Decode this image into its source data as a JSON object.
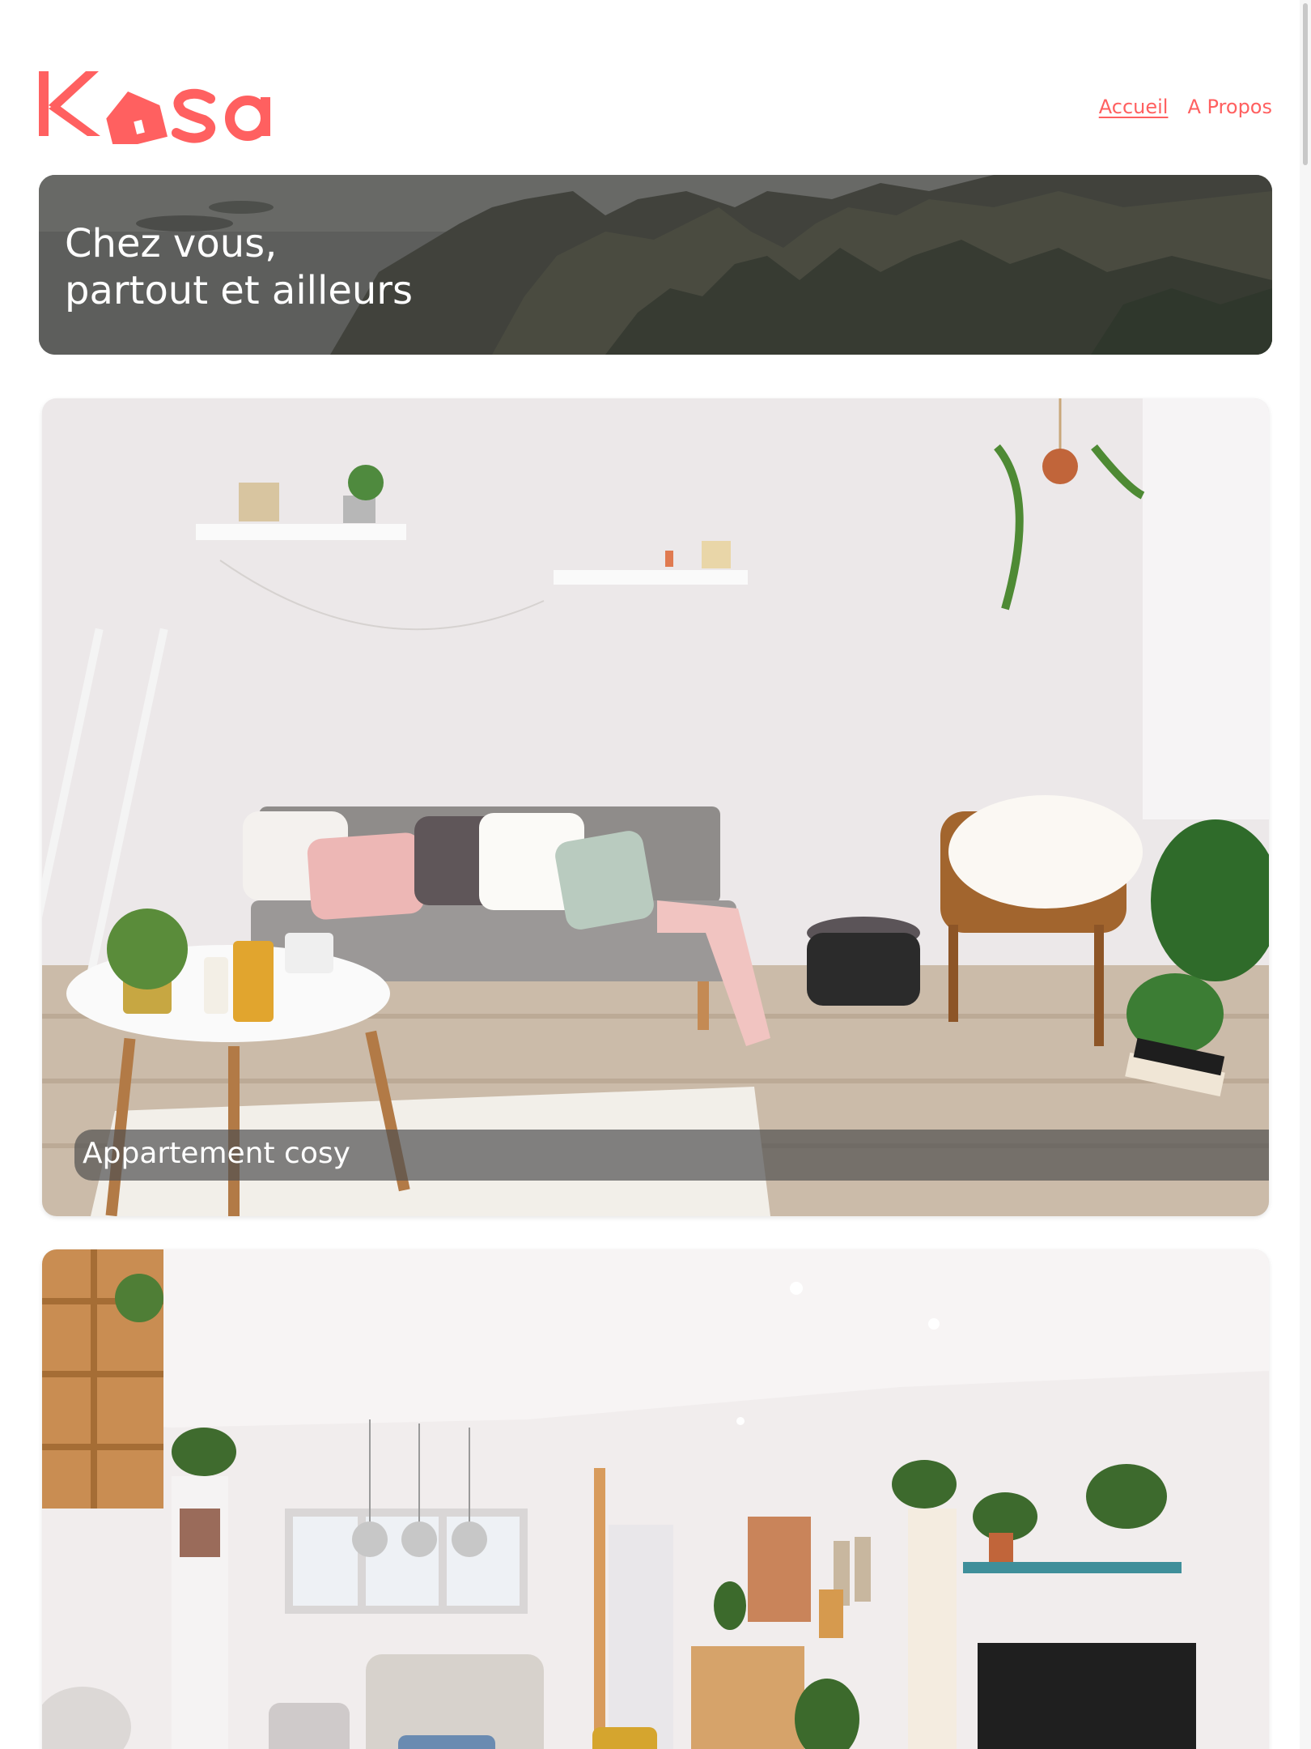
{
  "brand": {
    "logo_text": "Kasa",
    "color": "#ff6060"
  },
  "nav": {
    "items": [
      {
        "label": "Accueil",
        "active": true
      },
      {
        "label": "A Propos",
        "active": false
      }
    ]
  },
  "banner": {
    "title": "Chez vous,\npartout et ailleurs"
  },
  "listings": [
    {
      "title": "Appartement cosy"
    },
    {
      "title": ""
    }
  ]
}
